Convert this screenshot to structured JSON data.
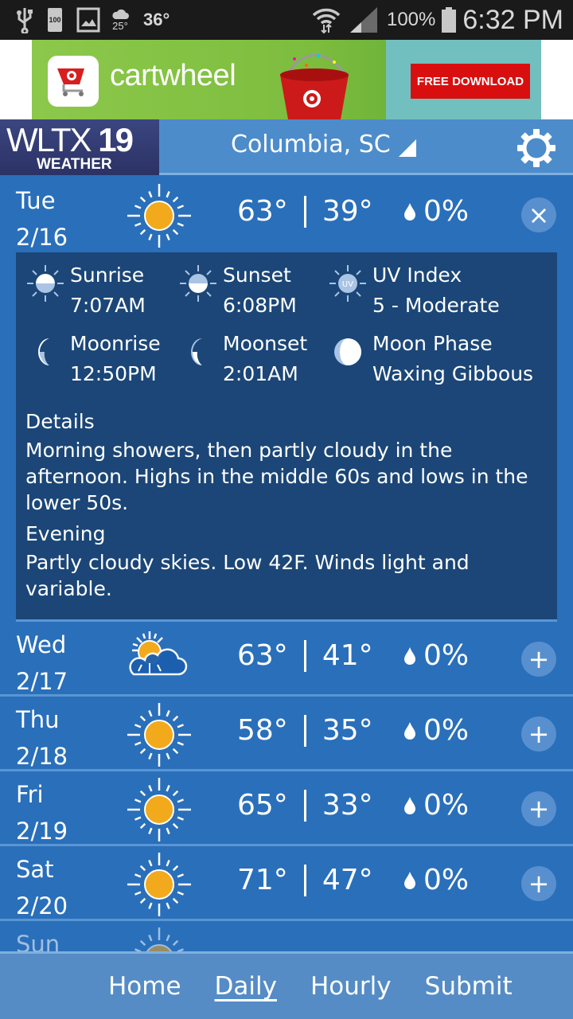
{
  "status_bar": {
    "notification_temp": "25°",
    "temperature": "36°",
    "battery_icon_label": "100",
    "battery_percent": "100%",
    "time": "6:32 PM",
    "icons": [
      "usb-icon",
      "battery-saver-icon",
      "gallery-icon",
      "weather-cloud-icon",
      "wifi-icon",
      "signal-icon",
      "battery-icon"
    ]
  },
  "ad": {
    "brand": "cartwheel",
    "cta": "FREE DOWNLOAD",
    "colors": {
      "green": "#7dbd3e",
      "teal": "#72bfbf",
      "red": "#d90f0f"
    }
  },
  "header": {
    "logo_main": "WLTX",
    "logo_number": "19",
    "logo_sub": "WEATHER",
    "location": "Columbia, SC"
  },
  "forecast": [
    {
      "day": "Tue",
      "date": "2/16",
      "icon": "sunny",
      "high": "63°",
      "low": "39°",
      "precip": "0%",
      "expanded": true
    },
    {
      "day": "Wed",
      "date": "2/17",
      "icon": "partly-cloudy",
      "high": "63°",
      "low": "41°",
      "precip": "0%",
      "expanded": false
    },
    {
      "day": "Thu",
      "date": "2/18",
      "icon": "sunny",
      "high": "58°",
      "low": "35°",
      "precip": "0%",
      "expanded": false
    },
    {
      "day": "Fri",
      "date": "2/19",
      "icon": "sunny",
      "high": "65°",
      "low": "33°",
      "precip": "0%",
      "expanded": false
    },
    {
      "day": "Sat",
      "date": "2/20",
      "icon": "sunny",
      "high": "71°",
      "low": "47°",
      "precip": "0%",
      "expanded": false
    },
    {
      "day": "Sun",
      "date": "",
      "icon": "sunny",
      "partial": true
    }
  ],
  "details": {
    "sunrise_label": "Sunrise",
    "sunrise": "7:07AM",
    "sunset_label": "Sunset",
    "sunset": "6:08PM",
    "uv_label": "UV Index",
    "uv": "5 - Moderate",
    "uv_icon_text": "UV",
    "moonrise_label": "Moonrise",
    "moonrise": "12:50PM",
    "moonset_label": "Moonset",
    "moonset": "2:01AM",
    "moonphase_label": "Moon Phase",
    "moonphase": "Waxing Gibbous",
    "details_title": "Details",
    "details_text": "Morning showers, then partly cloudy in the afternoon. Highs in the middle 60s and lows in the lower 50s.",
    "evening_title": "Evening",
    "evening_text": "Partly cloudy skies. Low 42F. Winds light and variable."
  },
  "bottom_nav": {
    "items": [
      "Home",
      "Daily",
      "Hourly",
      "Submit"
    ],
    "active": "Daily"
  },
  "colors": {
    "list_bg": "#2a6fba",
    "details_bg": "#1b4677",
    "header_bg": "#4d8ccb",
    "nav_bg": "#558cc6",
    "sun": "#f2a91c"
  }
}
